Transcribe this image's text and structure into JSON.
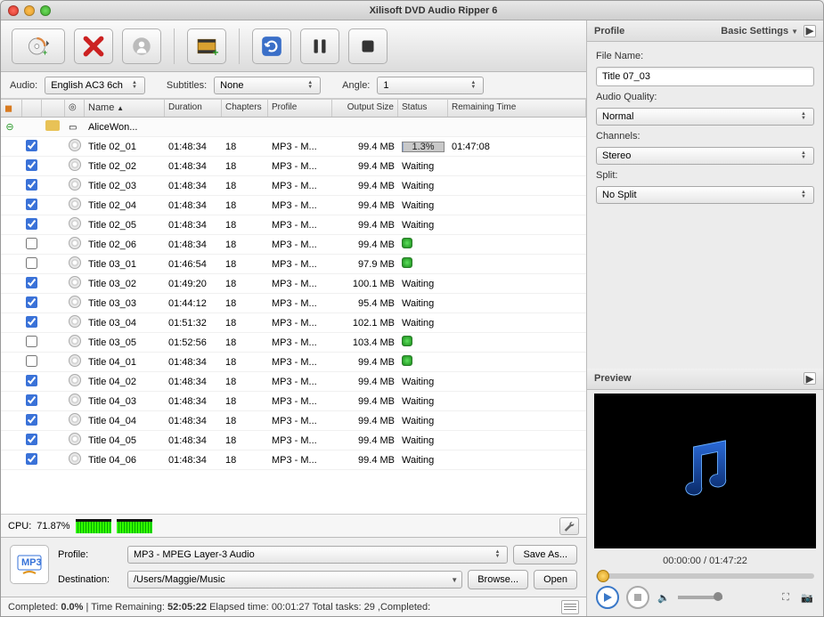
{
  "window": {
    "title": "Xilisoft DVD Audio Ripper 6"
  },
  "filters": {
    "audio_label": "Audio:",
    "audio_value": "English AC3 6ch",
    "subtitles_label": "Subtitles:",
    "subtitles_value": "None",
    "angle_label": "Angle:",
    "angle_value": "1"
  },
  "columns": {
    "name": "Name",
    "duration": "Duration",
    "chapters": "Chapters",
    "profile": "Profile",
    "output_size": "Output Size",
    "status": "Status",
    "remaining": "Remaining Time"
  },
  "parent_row": {
    "name": "AliceWon..."
  },
  "rows": [
    {
      "checked": true,
      "name": "Title 02_01",
      "dur": "01:48:34",
      "chap": "18",
      "prof": "MP3 - M...",
      "size": "99.4 MB",
      "status": "progress",
      "progress": "1.3%",
      "rem": "01:47:08"
    },
    {
      "checked": true,
      "name": "Title 02_02",
      "dur": "01:48:34",
      "chap": "18",
      "prof": "MP3 - M...",
      "size": "99.4 MB",
      "status": "Waiting",
      "rem": ""
    },
    {
      "checked": true,
      "name": "Title 02_03",
      "dur": "01:48:34",
      "chap": "18",
      "prof": "MP3 - M...",
      "size": "99.4 MB",
      "status": "Waiting",
      "rem": ""
    },
    {
      "checked": true,
      "name": "Title 02_04",
      "dur": "01:48:34",
      "chap": "18",
      "prof": "MP3 - M...",
      "size": "99.4 MB",
      "status": "Waiting",
      "rem": ""
    },
    {
      "checked": true,
      "name": "Title 02_05",
      "dur": "01:48:34",
      "chap": "18",
      "prof": "MP3 - M...",
      "size": "99.4 MB",
      "status": "Waiting",
      "rem": ""
    },
    {
      "checked": false,
      "name": "Title 02_06",
      "dur": "01:48:34",
      "chap": "18",
      "prof": "MP3 - M...",
      "size": "99.4 MB",
      "status": "green",
      "rem": ""
    },
    {
      "checked": false,
      "name": "Title 03_01",
      "dur": "01:46:54",
      "chap": "18",
      "prof": "MP3 - M...",
      "size": "97.9 MB",
      "status": "green",
      "rem": ""
    },
    {
      "checked": true,
      "name": "Title 03_02",
      "dur": "01:49:20",
      "chap": "18",
      "prof": "MP3 - M...",
      "size": "100.1 MB",
      "status": "Waiting",
      "rem": ""
    },
    {
      "checked": true,
      "name": "Title 03_03",
      "dur": "01:44:12",
      "chap": "18",
      "prof": "MP3 - M...",
      "size": "95.4 MB",
      "status": "Waiting",
      "rem": ""
    },
    {
      "checked": true,
      "name": "Title 03_04",
      "dur": "01:51:32",
      "chap": "18",
      "prof": "MP3 - M...",
      "size": "102.1 MB",
      "status": "Waiting",
      "rem": ""
    },
    {
      "checked": false,
      "name": "Title 03_05",
      "dur": "01:52:56",
      "chap": "18",
      "prof": "MP3 - M...",
      "size": "103.4 MB",
      "status": "green",
      "rem": ""
    },
    {
      "checked": false,
      "name": "Title 04_01",
      "dur": "01:48:34",
      "chap": "18",
      "prof": "MP3 - M...",
      "size": "99.4 MB",
      "status": "green",
      "rem": ""
    },
    {
      "checked": true,
      "name": "Title 04_02",
      "dur": "01:48:34",
      "chap": "18",
      "prof": "MP3 - M...",
      "size": "99.4 MB",
      "status": "Waiting",
      "rem": ""
    },
    {
      "checked": true,
      "name": "Title 04_03",
      "dur": "01:48:34",
      "chap": "18",
      "prof": "MP3 - M...",
      "size": "99.4 MB",
      "status": "Waiting",
      "rem": ""
    },
    {
      "checked": true,
      "name": "Title 04_04",
      "dur": "01:48:34",
      "chap": "18",
      "prof": "MP3 - M...",
      "size": "99.4 MB",
      "status": "Waiting",
      "rem": ""
    },
    {
      "checked": true,
      "name": "Title 04_05",
      "dur": "01:48:34",
      "chap": "18",
      "prof": "MP3 - M...",
      "size": "99.4 MB",
      "status": "Waiting",
      "rem": ""
    },
    {
      "checked": true,
      "name": "Title 04_06",
      "dur": "01:48:34",
      "chap": "18",
      "prof": "MP3 - M...",
      "size": "99.4 MB",
      "status": "Waiting",
      "rem": ""
    }
  ],
  "cpu": {
    "label": "CPU:",
    "value": "71.87%"
  },
  "profile_panel": {
    "profile_label": "Profile:",
    "profile_value": "MP3 - MPEG Layer-3 Audio",
    "save_as": "Save As...",
    "destination_label": "Destination:",
    "destination_value": "/Users/Maggie/Music",
    "browse": "Browse...",
    "open": "Open"
  },
  "status": {
    "completed_label": "Completed:",
    "completed_value": "0.0%",
    "time_remaining_label": "Time Remaining:",
    "time_remaining_value": "52:05:22",
    "elapsed_label": "Elapsed time:",
    "elapsed_value": "00:01:27",
    "total_tasks_label": "Total tasks:",
    "total_tasks_value": "29",
    "tail": ",Completed:"
  },
  "right_panel": {
    "profile_title": "Profile",
    "basic_settings": "Basic Settings",
    "file_name_label": "File Name:",
    "file_name_value": "Title 07_03",
    "audio_quality_label": "Audio Quality:",
    "audio_quality_value": "Normal",
    "channels_label": "Channels:",
    "channels_value": "Stereo",
    "split_label": "Split:",
    "split_value": "No Split",
    "preview_title": "Preview",
    "time": "00:00:00 / 01:47:22"
  }
}
